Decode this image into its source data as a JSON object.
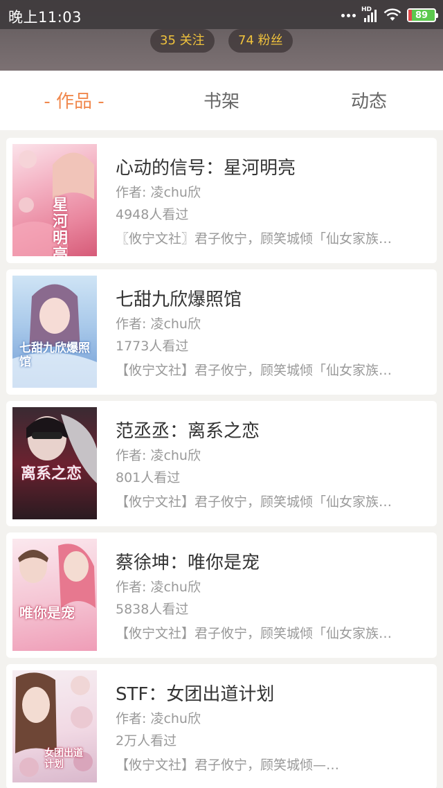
{
  "status_bar": {
    "time": "晚上11:03",
    "network": "HD",
    "battery": "89"
  },
  "profile": {
    "following": "35 关注",
    "fans": "74 粉丝"
  },
  "tabs": [
    {
      "label": "- 作品 -",
      "active": true
    },
    {
      "label": "书架",
      "active": false
    },
    {
      "label": "动态",
      "active": false
    }
  ],
  "books": [
    {
      "title": "心动的信号：星河明亮",
      "author": "作者: 凌chu欣",
      "views": "4948人看过",
      "description": "〖攸宁文社〗君子攸宁，顾笑城倾「仙女家族…",
      "cover_text": "星河明亮"
    },
    {
      "title": "七甜九欣爆照馆",
      "author": "作者: 凌chu欣",
      "views": "1773人看过",
      "description": "【攸宁文社】君子攸宁，顾笑城倾「仙女家族…",
      "cover_text": "七甜九欣爆照馆"
    },
    {
      "title": "范丞丞：离系之恋",
      "author": "作者: 凌chu欣",
      "views": "801人看过",
      "description": "【攸宁文社】君子攸宁，顾笑城倾「仙女家族…",
      "cover_text": "离系之恋"
    },
    {
      "title": "蔡徐坤：唯你是宠",
      "author": "作者: 凌chu欣",
      "views": "5838人看过",
      "description": "【攸宁文社】君子攸宁，顾笑城倾「仙女家族…",
      "cover_text": "唯你是宠"
    },
    {
      "title": "STF：女团出道计划",
      "author": "作者: 凌chu欣",
      "views": "2万人看过",
      "description": "【攸宁文社】君子攸宁，顾笑城倾—…",
      "cover_text": "女团出道计划"
    }
  ],
  "colors": {
    "accent": "#f0884d",
    "follow_text": "#f0c23c",
    "battery": "#5cc94e"
  }
}
